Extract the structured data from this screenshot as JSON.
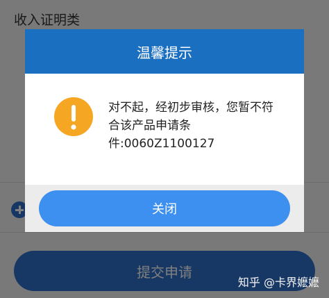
{
  "page": {
    "section_title": "收入证明类",
    "submit_label": "提交申请"
  },
  "dialog": {
    "title": "温馨提示",
    "message_lines": [
      "对不起，经初步审核，您暂不符",
      "合该产品申请条",
      "件:0060Z1100127"
    ],
    "close_label": "关闭"
  },
  "watermark": "知乎 @卡界嬷嬷",
  "colors": {
    "header_blue": "#1a6fc0",
    "button_blue": "#3d8ff0",
    "warning_orange": "#f5a623"
  },
  "icons": {
    "warning": "exclamation-circle-icon",
    "add": "plus-circle-icon"
  }
}
